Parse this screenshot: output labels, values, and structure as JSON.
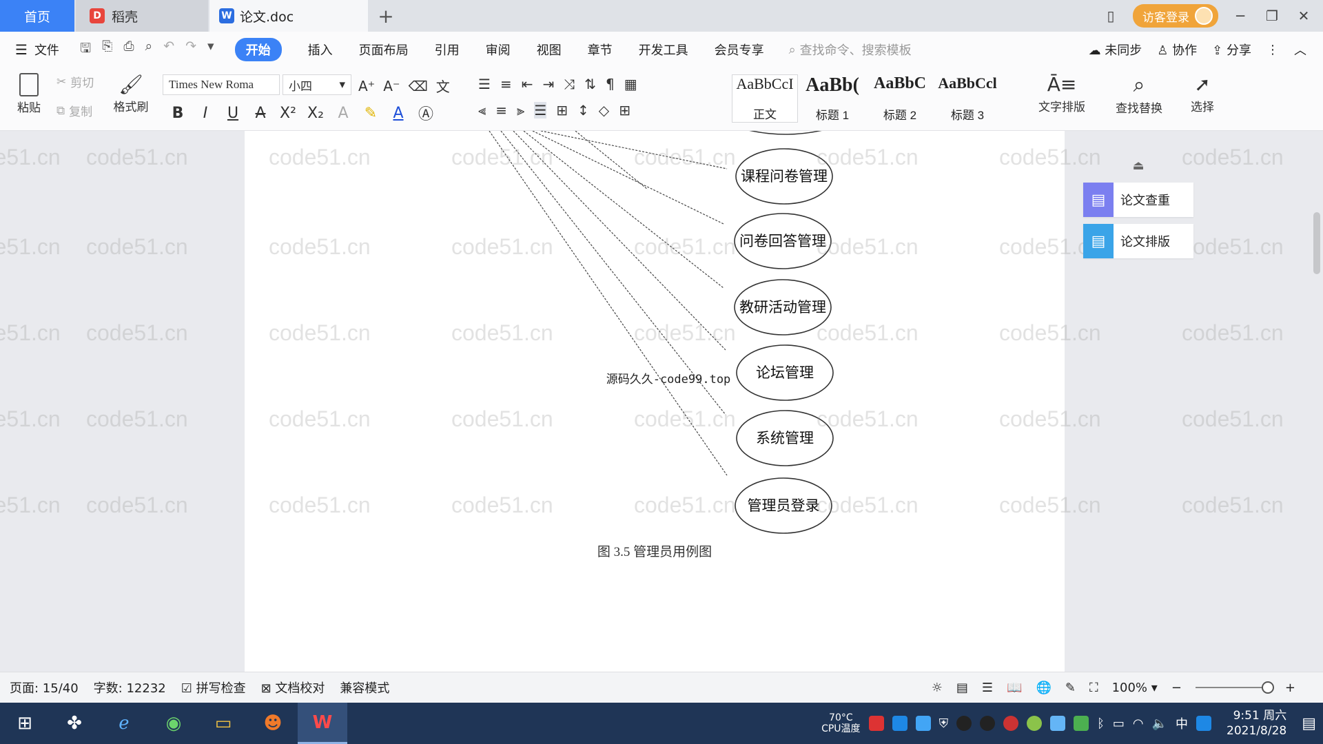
{
  "tabs": {
    "home": "首页",
    "daoke": "稻壳",
    "doc": "论文.doc",
    "add": "+"
  },
  "titlebar": {
    "login": "访客登录"
  },
  "menu": {
    "file": "文件",
    "tabs": [
      "开始",
      "插入",
      "页面布局",
      "引用",
      "审阅",
      "视图",
      "章节",
      "开发工具",
      "会员专享"
    ],
    "search_placeholder": "查找命令、搜索模板",
    "sync": "未同步",
    "collab": "协作",
    "share": "分享"
  },
  "ribbon": {
    "paste": "粘贴",
    "cut": "剪切",
    "copy": "复制",
    "format_painter": "格式刷",
    "font_name": "Times New Roma",
    "font_size": "小四",
    "styles": [
      {
        "sample": "AaBbCcI",
        "label": "正文"
      },
      {
        "sample": "AaBb(",
        "label": "标题 1"
      },
      {
        "sample": "AaBbC",
        "label": "标题 2"
      },
      {
        "sample": "AaBbCcl",
        "label": "标题 3"
      }
    ],
    "text_layout": "文字排版",
    "find_replace": "查找替换",
    "select": "选择"
  },
  "document": {
    "usecases": [
      "课程问卷管理",
      "问卷回答管理",
      "教研活动管理",
      "论坛管理",
      "系统管理",
      "管理员登录"
    ],
    "source_note": "源码久久-code99.top",
    "caption": "图 3.5  管理员用例图",
    "watermark": "code51.cn"
  },
  "side_panel": {
    "check": "论文查重",
    "layout": "论文排版"
  },
  "status": {
    "page": "页面: 15/40",
    "words": "字数: 12232",
    "spell": "拼写检查",
    "proof": "文档校对",
    "compat": "兼容模式",
    "zoom": "100%"
  },
  "taskbar": {
    "cpu_temp": "70°C",
    "cpu_label": "CPU温度",
    "ime": "中",
    "time": "9:51 周六",
    "date": "2021/8/28"
  }
}
